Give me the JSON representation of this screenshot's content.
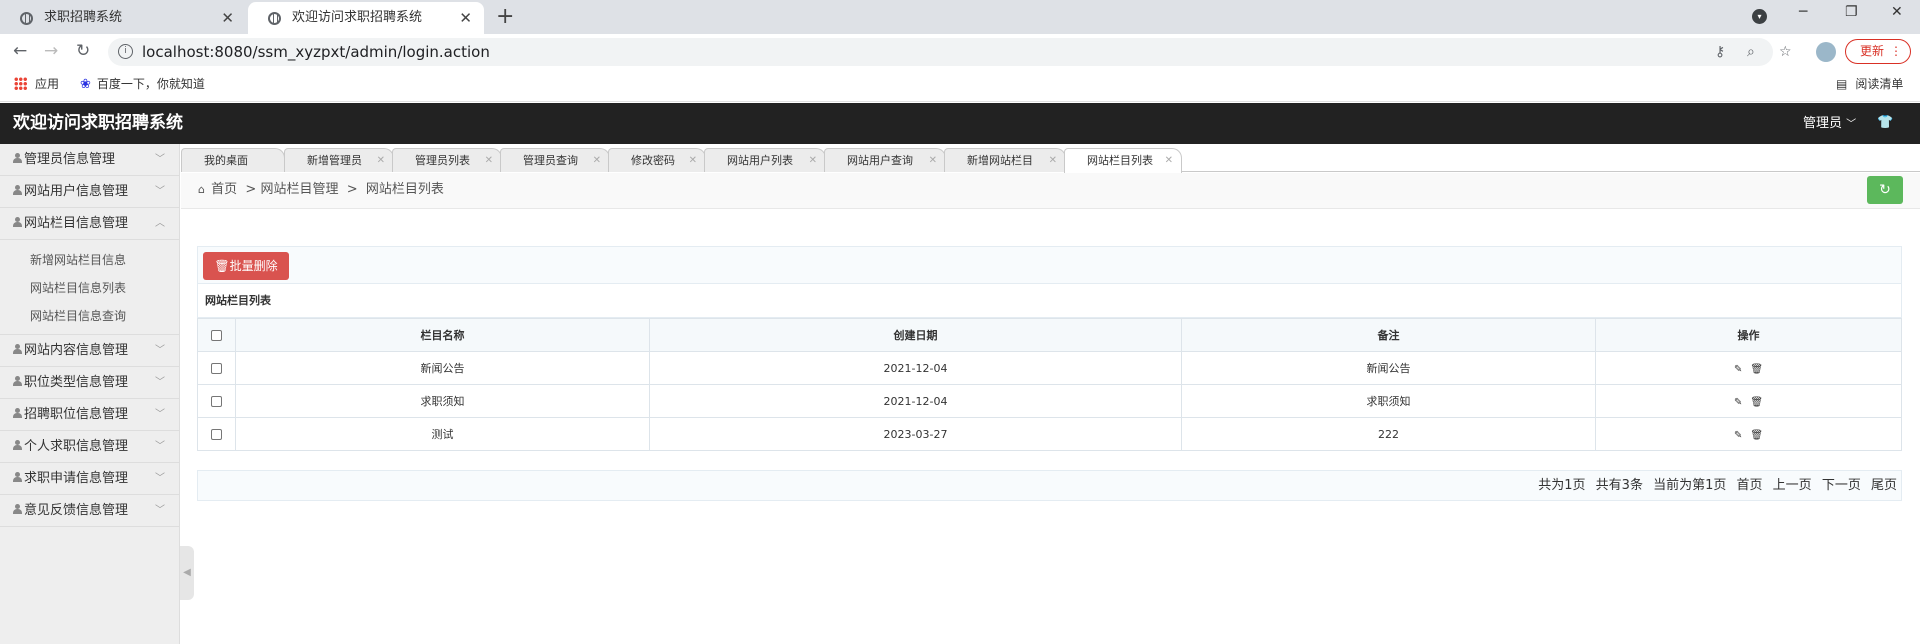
{
  "browser": {
    "tabs": [
      {
        "title": "求职招聘系统",
        "active": false
      },
      {
        "title": "欢迎访问求职招聘系统",
        "active": true
      }
    ],
    "url": "localhost:8080/ssm_xyzpxt/admin/login.action",
    "update_label": "更新",
    "bookmarks": [
      {
        "label": "应用",
        "icon": "apps-icon"
      },
      {
        "label": "百度一下，你就知道",
        "icon": "baidu-icon"
      }
    ],
    "reading_list": "阅读清单"
  },
  "app": {
    "title": "欢迎访问求职招聘系统",
    "admin_label": "管理员"
  },
  "sidebar": {
    "items": [
      {
        "label": "管理员信息管理",
        "expanded": false
      },
      {
        "label": "网站用户信息管理",
        "expanded": false
      },
      {
        "label": "网站栏目信息管理",
        "expanded": true
      },
      {
        "label": "网站内容信息管理",
        "expanded": false
      },
      {
        "label": "职位类型信息管理",
        "expanded": false
      },
      {
        "label": "招聘职位信息管理",
        "expanded": false
      },
      {
        "label": "个人求职信息管理",
        "expanded": false
      },
      {
        "label": "求职申请信息管理",
        "expanded": false
      },
      {
        "label": "意见反馈信息管理",
        "expanded": false
      }
    ],
    "submenu": [
      "新增网站栏目信息",
      "网站栏目信息列表",
      "网站栏目信息查询"
    ]
  },
  "page_tabs": [
    "我的桌面",
    "新增管理员",
    "管理员列表",
    "管理员查询",
    "修改密码",
    "网站用户列表",
    "网站用户查询",
    "新增网站栏目",
    "网站栏目列表"
  ],
  "breadcrumb": {
    "home": "首页",
    "sep": ">",
    "level1": "网站栏目管理",
    "level2": "网站栏目列表"
  },
  "toolbar": {
    "batch_delete_label": "批量删除"
  },
  "list": {
    "caption": "网站栏目列表",
    "columns": [
      "栏目名称",
      "创建日期",
      "备注",
      "操作"
    ],
    "rows": [
      {
        "name": "新闻公告",
        "date": "2021-12-04",
        "note": "新闻公告"
      },
      {
        "name": "求职须知",
        "date": "2021-12-04",
        "note": "求职须知"
      },
      {
        "name": "测试",
        "date": "2023-03-27",
        "note": "222"
      }
    ]
  },
  "pager": {
    "total_pages": "共为1页",
    "total_records": "共有3条",
    "current": "当前为第1页",
    "first": "首页",
    "prev": "上一页",
    "next": "下一页",
    "last": "尾页"
  }
}
